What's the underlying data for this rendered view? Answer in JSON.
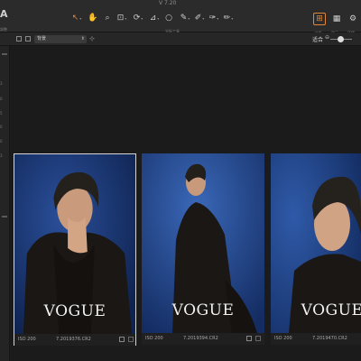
{
  "window": {
    "title": "V 7.20"
  },
  "app": {
    "logo": "A",
    "sub": "調整"
  },
  "toolbar": {
    "caption": "光标工具",
    "tools": [
      {
        "name": "select-tool",
        "glyph": "↖",
        "active": true
      },
      {
        "name": "hand-tool",
        "glyph": "✋"
      },
      {
        "name": "zoom-tool",
        "glyph": "⌕"
      },
      {
        "name": "crop-tool",
        "glyph": "⊡"
      },
      {
        "name": "rotate-tool",
        "glyph": "⟳"
      },
      {
        "name": "keystone-tool",
        "glyph": "⊿"
      },
      {
        "name": "spot-tool",
        "glyph": "○"
      },
      {
        "name": "color-picker-tool",
        "glyph": "✎"
      },
      {
        "name": "brush-tool",
        "glyph": "✐"
      },
      {
        "name": "eraser-tool",
        "glyph": "✑"
      },
      {
        "name": "gradient-tool",
        "glyph": "✏"
      }
    ],
    "right": [
      {
        "label": "过滤",
        "glyph": "⊞",
        "active": true
      },
      {
        "label": "显示",
        "glyph": "▦"
      },
      {
        "label": "环境",
        "glyph": "⚙"
      }
    ]
  },
  "options": {
    "select_value": "背景",
    "fit_label": "适合"
  },
  "rail": {
    "ticks": [
      "3",
      "0",
      "5",
      "0",
      "0",
      "3"
    ]
  },
  "thumbnails": [
    {
      "iso": "ISO 200",
      "file": "7.2019376.CR2",
      "brand": "VOGUE",
      "selected": true
    },
    {
      "iso": "ISO 200",
      "file": "7.2019394.CR2",
      "brand": "VOGUE",
      "selected": false
    },
    {
      "iso": "ISO 200",
      "file": "7.2019470.CR2",
      "brand": "VOGUE",
      "selected": false
    }
  ],
  "colors": {
    "accent": "#e0873a",
    "backdrop": "#1c3a78",
    "coat": "#1a1714"
  }
}
